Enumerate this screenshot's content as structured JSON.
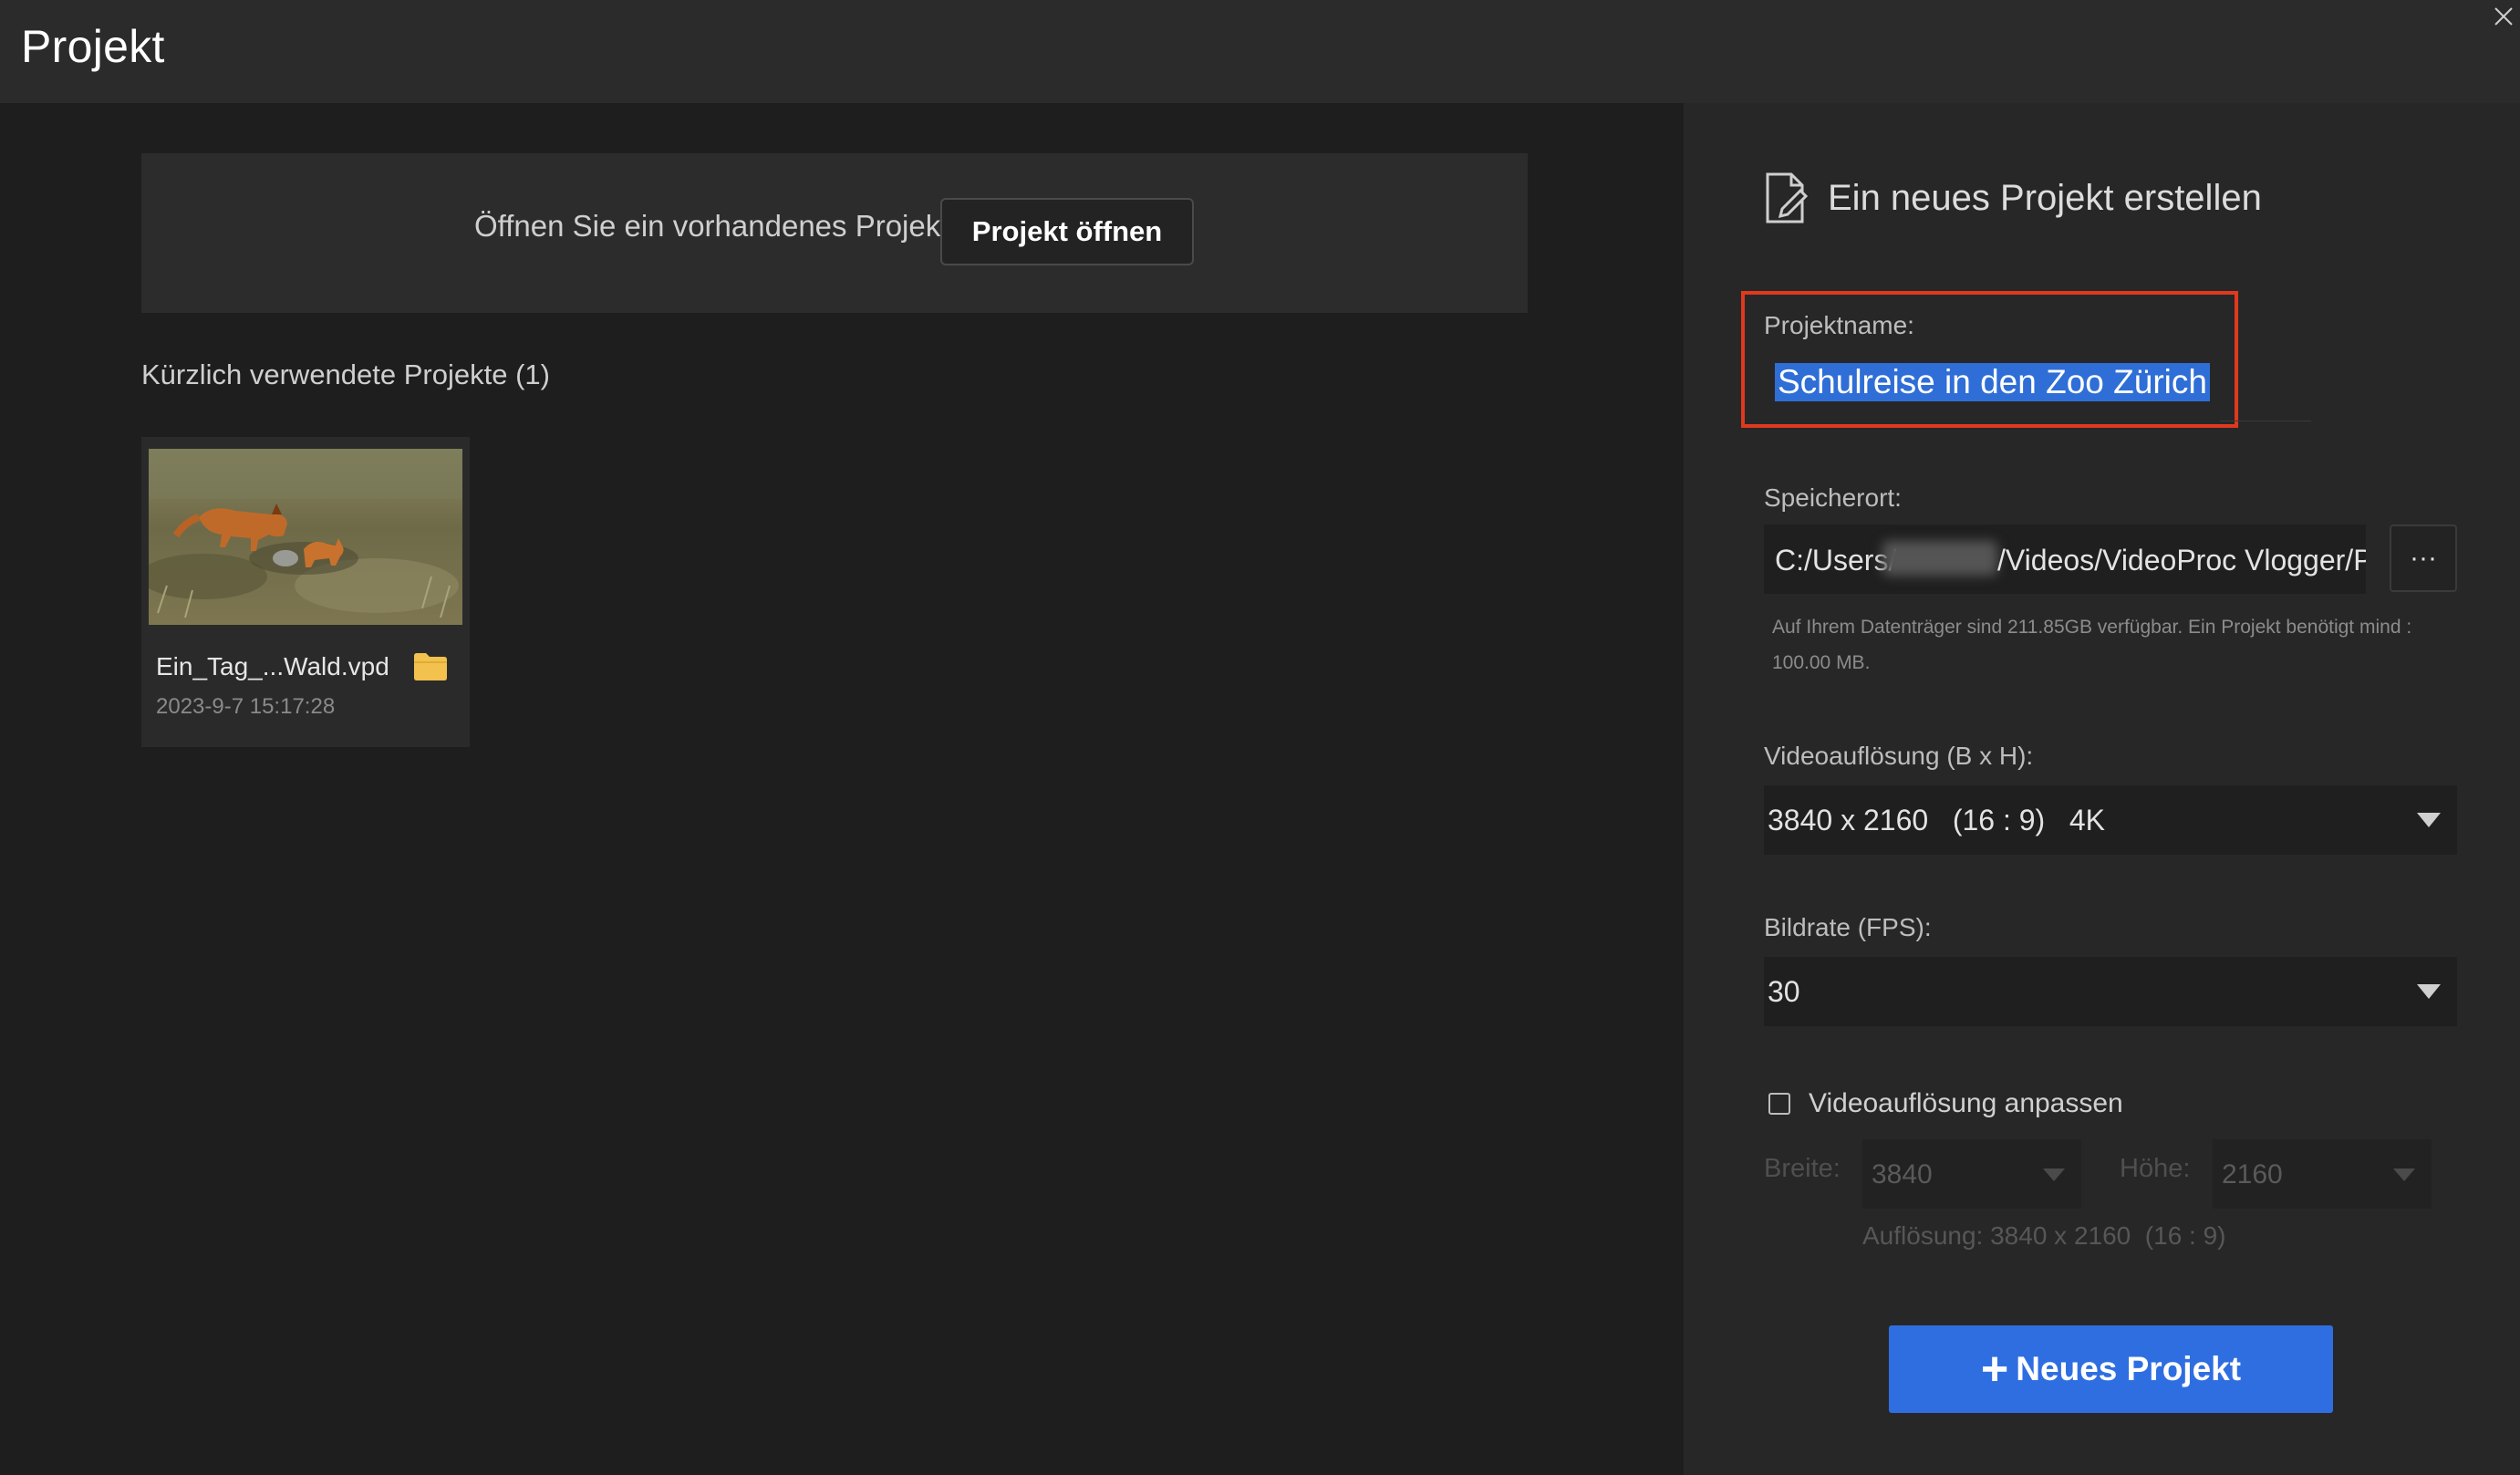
{
  "window": {
    "title": "Projekt"
  },
  "open_section": {
    "text": "Öffnen Sie ein vorhandenes Projekt",
    "button_label": "Projekt öffnen"
  },
  "recent": {
    "title": "Kürzlich verwendete Projekte (1)",
    "items": [
      {
        "file_name": "Ein_Tag_...Wald.vpd",
        "date": "2023-9-7 15:17:28",
        "thumbnail_icon": "fox-photo-thumbnail",
        "folder_icon": "folder-icon"
      }
    ]
  },
  "new_project": {
    "header": "Ein neues Projekt erstellen",
    "header_icon": "new-document-icon",
    "name_label": "Projektname:",
    "name_value": "Schulreise in den Zoo Zürich",
    "location_label": "Speicherort:",
    "location_prefix": "C:/Users/",
    "location_suffix": "/Videos/VideoProc Vlogger/Projects",
    "browse_label": "···",
    "disk_info": "Auf Ihrem Datenträger sind 211.85GB verfügbar. Ein Projekt benötigt mind : 100.00 MB.",
    "resolution_label": "Videoauflösung (B x H):",
    "resolution_value": "3840 x 2160   (16 : 9)   4K",
    "fps_label": "Bildrate (FPS):",
    "fps_value": "30",
    "custom_label": "Videoauflösung anpassen",
    "custom_checked": false,
    "width_label": "Breite:",
    "width_value": "3840",
    "height_label": "Höhe:",
    "height_value": "2160",
    "resolution_info": "Auflösung: 3840 x 2160  (16 : 9)",
    "create_button_label": "Neues Projekt"
  },
  "colors": {
    "accent_blue": "#2f6ee0",
    "highlight_red": "#e0391e",
    "folder_yellow": "#f2c14e"
  }
}
